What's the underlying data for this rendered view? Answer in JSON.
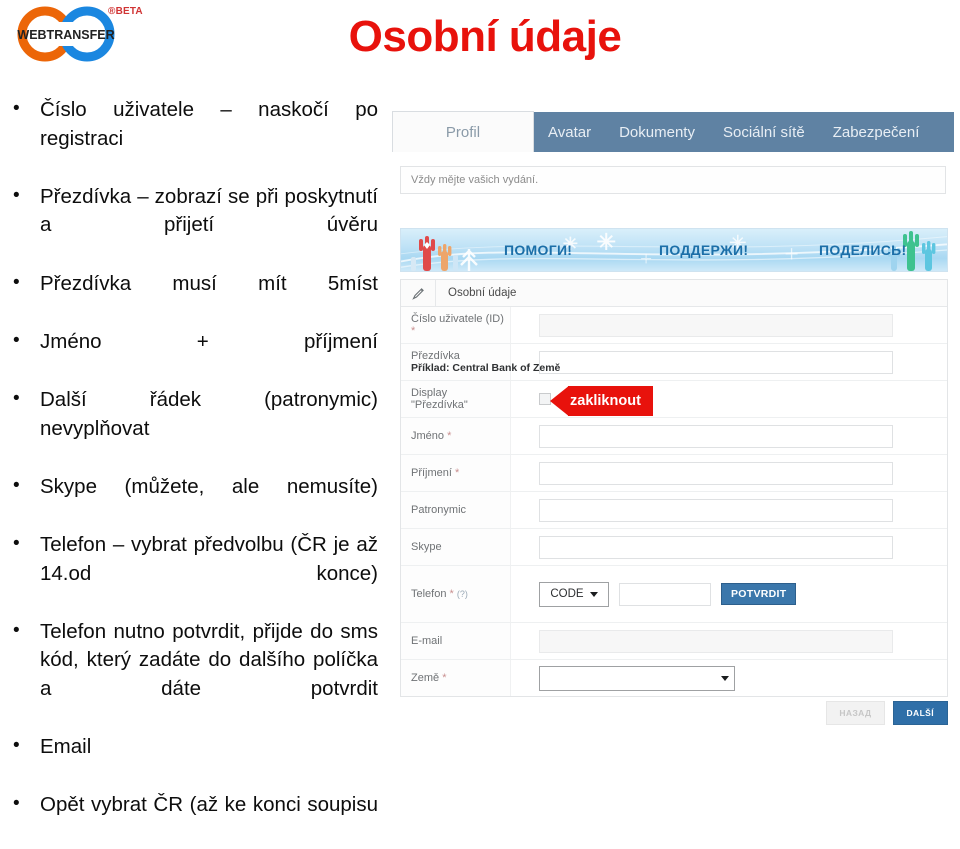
{
  "logo": {
    "wordmark": "WEBTRANSFER",
    "badge": "®BETA",
    "orange": "#ec6608",
    "blue": "#1b87e0"
  },
  "slide": {
    "title": "Osobní údaje",
    "title_color": "#e8120c"
  },
  "bullets": [
    "Číslo uživatele – naskočí po registraci",
    "Přezdívka – zobrazí se při poskytnutí a přijetí úvěru",
    "Přezdívka musí mít 5míst",
    "Jméno + příjmení",
    "Další řádek (patronymic) nevyplňovat",
    "Skype (můžete, ale nemusíte)",
    "Telefon – vybrat předvolbu (ČR je až 14.od konce)",
    "Telefon nutno potvrdit, přijde do sms kód, který zadáte do dalšího políčka a dáte potvrdit",
    "Email",
    "Opět vybrat ČR (až ke konci soupisu"
  ],
  "screenshot": {
    "tabs": [
      {
        "label": "Profil",
        "active": true
      },
      {
        "label": "Avatar",
        "active": false
      },
      {
        "label": "Dokumenty",
        "active": false
      },
      {
        "label": "Sociální sítě",
        "active": false
      },
      {
        "label": "Zabezpečení",
        "active": false
      }
    ],
    "tabbar_color": "#5f82a3",
    "notice": "Vždy mějte vašich vydání.",
    "banner": {
      "words": [
        "ПОМОГИ!",
        "ПОДДЕРЖИ!",
        "ПОДЕЛИСЬ!"
      ],
      "text_color": "#1c6fa8"
    },
    "form": {
      "header": "Osobní údaje",
      "header_icon": "pencil-icon",
      "rows": [
        {
          "label": "Číslo uživatele (ID)",
          "required": "*",
          "control": "text-disabled"
        },
        {
          "label": "Přezdívka",
          "sub": "Příklad: Central Bank of Země",
          "control": "text"
        },
        {
          "label": "Display \"Přezdívka\"",
          "control": "checkbox"
        },
        {
          "label": "Jméno",
          "required": "*",
          "control": "text"
        },
        {
          "label": "Příjmení",
          "required": "*",
          "control": "text"
        },
        {
          "label": "Patronymic",
          "control": "text"
        },
        {
          "label": "Skype",
          "control": "text"
        },
        {
          "label": "Telefon",
          "required": "*",
          "hint": "(?)",
          "control": "phone"
        },
        {
          "label": "E-mail",
          "control": "text"
        },
        {
          "label": "Země",
          "required": "*",
          "control": "select"
        }
      ],
      "phone_code_label": "CODE",
      "phone_confirm_label": "POTVRDIT",
      "confirm_color": "#3b77ab"
    },
    "footer": {
      "back_label": "НАЗАД",
      "next_label": "DALŠÍ",
      "next_color": "#2f6fa8"
    }
  },
  "callout": {
    "label": "zakliknout",
    "color": "#e8120c"
  }
}
